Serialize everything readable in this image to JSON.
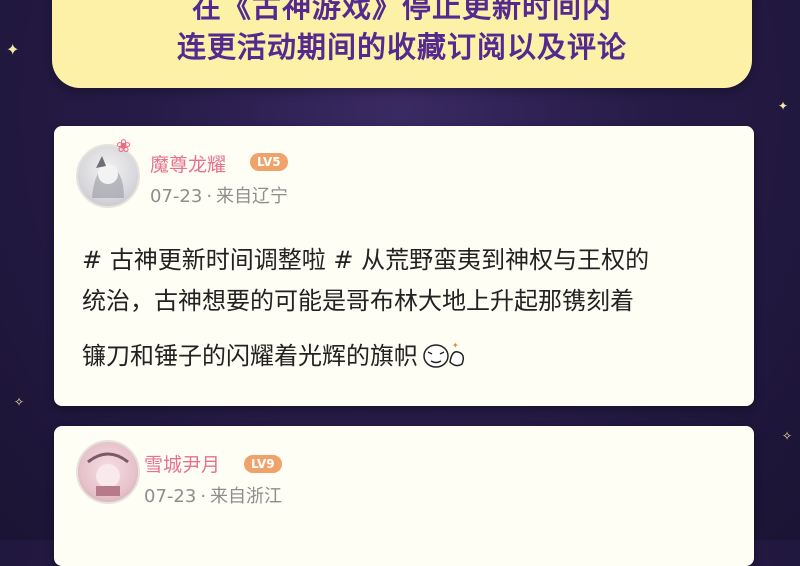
{
  "banner": {
    "line1": "在《古神游戏》停止更新时间内",
    "line2": "连更活动期间的收藏订阅以及评论"
  },
  "posts": [
    {
      "username": "魔尊龙耀",
      "level": "LV5",
      "date": "07-23",
      "separator": "·",
      "location": "来自辽宁",
      "content_line1": "# 古神更新时间调整啦 # 从荒野蛮夷到神权与王权的",
      "content_line2": "统治，古神想要的可能是哥布林大地上升起那镌刻着",
      "content_line3": "镰刀和锤子的闪耀着光辉的旗帜",
      "emoji": "sticker-emoji"
    },
    {
      "username": "雪城尹月",
      "level": "LV9",
      "date": "07-23",
      "separator": "·",
      "location": "来自浙江"
    }
  ],
  "colors": {
    "background": "#261b47",
    "banner": "#fcf1a6",
    "banner_text": "#55298f",
    "username": "#e7728b",
    "level_badge": "#efa36b"
  }
}
